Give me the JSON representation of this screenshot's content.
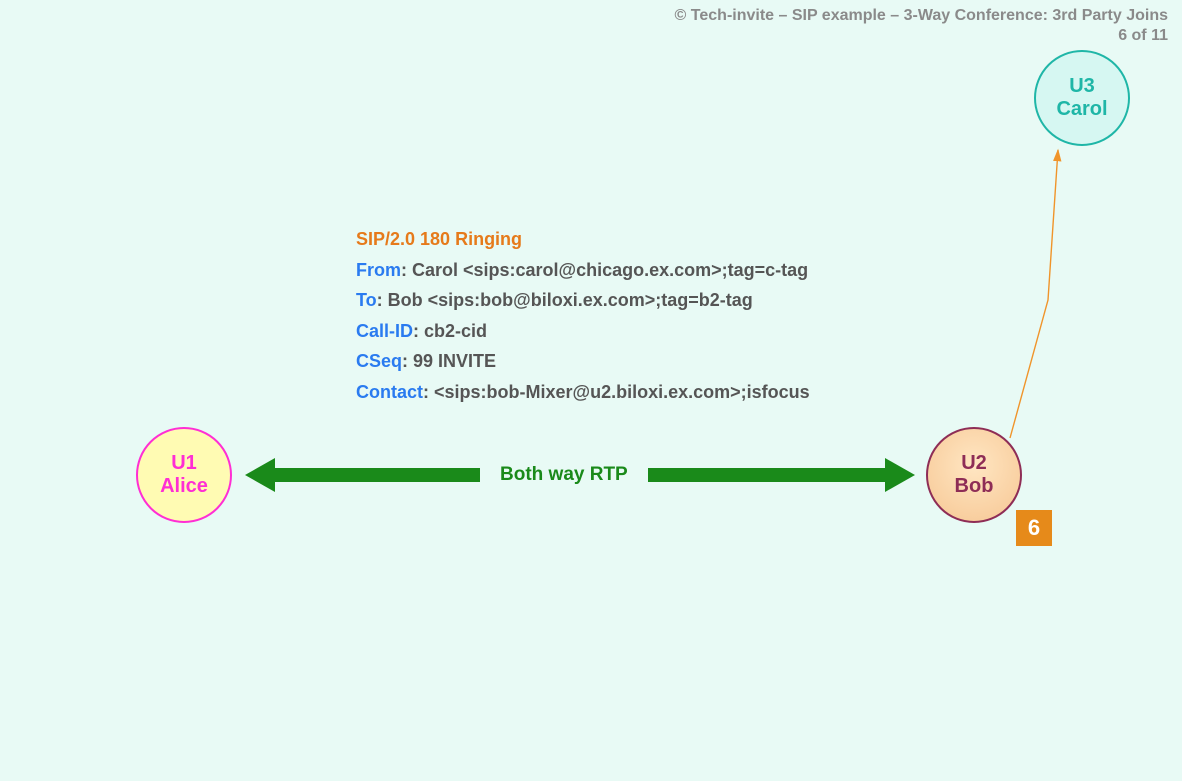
{
  "header": {
    "title": "© Tech-invite – SIP example – 3-Way Conference: 3rd Party Joins",
    "page": "6 of 11"
  },
  "nodes": {
    "u1": {
      "id": "U1",
      "name": "Alice"
    },
    "u2": {
      "id": "U2",
      "name": "Bob"
    },
    "u3": {
      "id": "U3",
      "name": "Carol"
    }
  },
  "rtp": {
    "label": "Both way RTP"
  },
  "step": {
    "number": "6"
  },
  "sip": {
    "status_line": "SIP/2.0 180 Ringing",
    "headers": {
      "from_key": "From",
      "from_val": ": Carol <sips:carol@chicago.ex.com>;tag=c-tag",
      "to_key": "To",
      "to_val": ": Bob <sips:bob@biloxi.ex.com>;tag=b2-tag",
      "callid_key": "Call-ID",
      "callid_val": ": cb2-cid",
      "cseq_key": "CSeq",
      "cseq_val": ": 99 INVITE",
      "contact_key": "Contact",
      "contact_val": ": <sips:bob-Mixer@u2.biloxi.ex.com>;isfocus"
    }
  }
}
